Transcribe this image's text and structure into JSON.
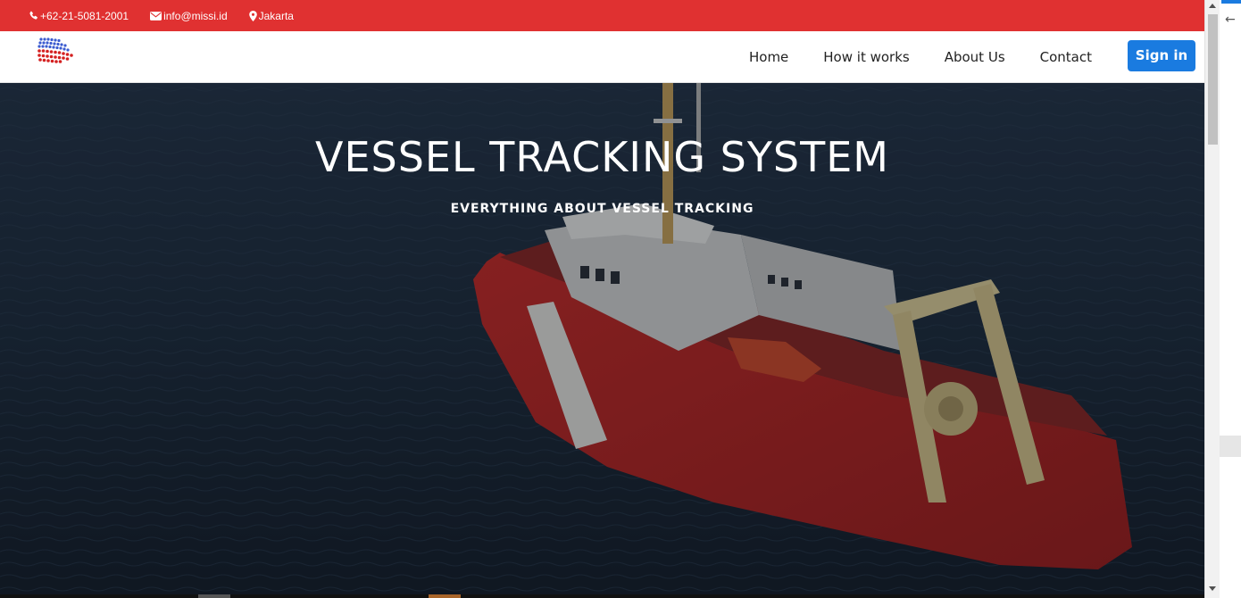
{
  "topbar": {
    "phone": "+62-21-5081-2001",
    "email": "info@missi.id",
    "location": "Jakarta",
    "background": "#e03131"
  },
  "navbar": {
    "links": [
      "Home",
      "How it works",
      "About Us",
      "Contact"
    ],
    "signin_label": "Sign in",
    "signin_color": "#1a7be0"
  },
  "hero": {
    "title": "VESSEL TRACKING SYSTEM",
    "subtitle": "EVERYTHING ABOUT VESSEL TRACKING"
  },
  "sidepanel": {
    "back_glyph": "←"
  }
}
